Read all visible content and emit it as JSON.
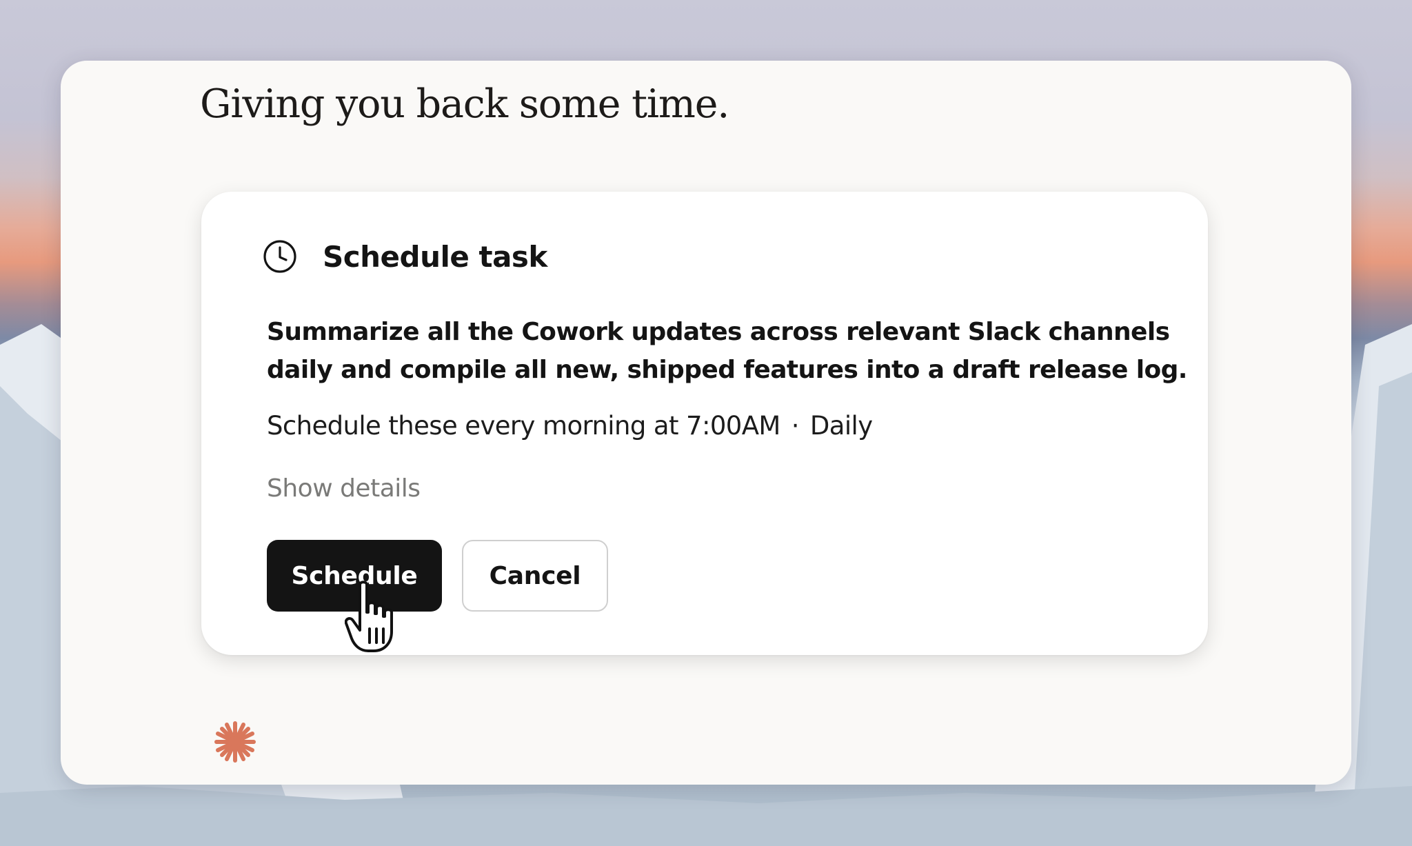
{
  "headline": "Giving you back some time.",
  "card": {
    "title": "Schedule task",
    "icon": "clock-icon",
    "description": "Summarize all the Cowork updates across relevant Slack channels daily and compile all new, shipped features into a draft release log.",
    "schedule_text": "Schedule these every morning at 7:00AM",
    "separator": "·",
    "frequency": "Daily",
    "show_details_label": "Show details",
    "primary_button_label": "Schedule",
    "secondary_button_label": "Cancel"
  },
  "colors": {
    "primary_button": "#141414",
    "logo_accent": "#d9775b",
    "window_bg": "#faf9f7"
  },
  "cursor": "hand-pointer-icon",
  "logo": "asterisk-logo-icon"
}
